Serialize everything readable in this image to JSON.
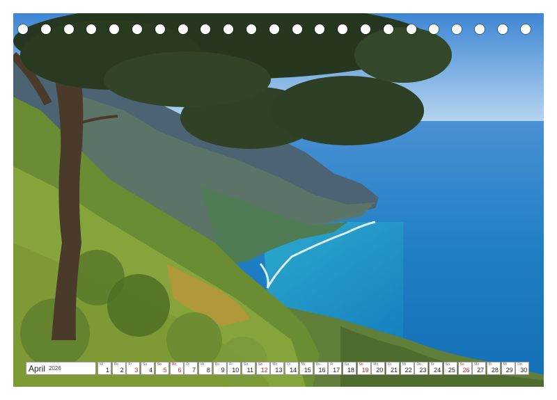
{
  "calendar": {
    "month": "April",
    "year": "2026",
    "days": [
      {
        "num": "1",
        "weekday": "Mi",
        "red": false
      },
      {
        "num": "2",
        "weekday": "Do",
        "red": false
      },
      {
        "num": "3",
        "weekday": "Fr",
        "red": true
      },
      {
        "num": "4",
        "weekday": "Sa",
        "red": false
      },
      {
        "num": "5",
        "weekday": "So",
        "red": true
      },
      {
        "num": "6",
        "weekday": "Mo",
        "red": true
      },
      {
        "num": "7",
        "weekday": "Di",
        "red": false
      },
      {
        "num": "8",
        "weekday": "Mi",
        "red": false
      },
      {
        "num": "9",
        "weekday": "Do",
        "red": false
      },
      {
        "num": "10",
        "weekday": "Fr",
        "red": false
      },
      {
        "num": "11",
        "weekday": "Sa",
        "red": false
      },
      {
        "num": "12",
        "weekday": "So",
        "red": true
      },
      {
        "num": "13",
        "weekday": "Mo",
        "red": false
      },
      {
        "num": "14",
        "weekday": "Di",
        "red": false
      },
      {
        "num": "15",
        "weekday": "Mi",
        "red": false
      },
      {
        "num": "16",
        "weekday": "Do",
        "red": false
      },
      {
        "num": "17",
        "weekday": "Fr",
        "red": false
      },
      {
        "num": "18",
        "weekday": "Sa",
        "red": false
      },
      {
        "num": "19",
        "weekday": "So",
        "red": true
      },
      {
        "num": "20",
        "weekday": "Mo",
        "red": false
      },
      {
        "num": "21",
        "weekday": "Di",
        "red": false
      },
      {
        "num": "22",
        "weekday": "Mi",
        "red": false
      },
      {
        "num": "23",
        "weekday": "Do",
        "red": false
      },
      {
        "num": "24",
        "weekday": "Fr",
        "red": false
      },
      {
        "num": "25",
        "weekday": "Sa",
        "red": false
      },
      {
        "num": "26",
        "weekday": "So",
        "red": true
      },
      {
        "num": "27",
        "weekday": "Mo",
        "red": false
      },
      {
        "num": "28",
        "weekday": "Di",
        "red": false
      },
      {
        "num": "29",
        "weekday": "Mi",
        "red": false
      },
      {
        "num": "30",
        "weekday": "Do",
        "red": false
      }
    ]
  },
  "binding_holes": 23,
  "colors": {
    "sky": "#6fa8dc",
    "sea": "#1f7fc4",
    "holiday_red": "#c0282d"
  }
}
